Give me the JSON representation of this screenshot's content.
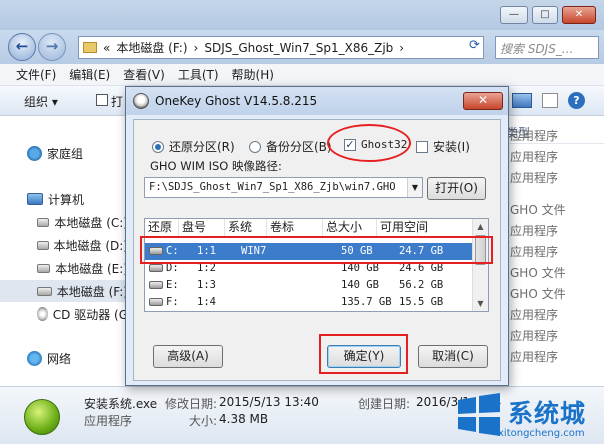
{
  "window": {
    "controls": {
      "minimize": "—",
      "maximize": "□",
      "close": "✕"
    }
  },
  "address": {
    "back": "←",
    "forward": "→",
    "crumbs": [
      "«",
      "本地磁盘 (F:)",
      "›",
      "SDJS_Ghost_Win7_Sp1_X86_Zjb",
      "›"
    ],
    "search_placeholder": "搜索 SDJS_..."
  },
  "menubar": [
    "文件(F)",
    "编辑(E)",
    "查看(V)",
    "工具(T)",
    "帮助(H)"
  ],
  "cmdbar": {
    "organize": "组织 ▾",
    "open_trunc": "打"
  },
  "navpane": {
    "items": [
      {
        "label": "家庭组",
        "icon": "homegroup-icon"
      },
      {
        "label": "计算机",
        "icon": "computer-icon"
      },
      {
        "label": "本地磁盘 (C:)",
        "icon": "drive-icon"
      },
      {
        "label": "本地磁盘 (D:)",
        "icon": "drive-icon"
      },
      {
        "label": "本地磁盘 (E:)",
        "icon": "drive-icon"
      },
      {
        "label": "本地磁盘 (F:)",
        "icon": "drive-icon"
      },
      {
        "label": "CD 驱动器 (G",
        "icon": "cd-drive-icon"
      },
      {
        "label": "网络",
        "icon": "network-icon"
      }
    ]
  },
  "filepane": {
    "col_header": "类型",
    "rows": [
      "应用程序",
      "应用程序",
      "应用程序",
      "GHO 文件",
      "应用程序",
      "应用程序",
      "GHO 文件",
      "GHO 文件",
      "应用程序",
      "应用程序",
      "应用程序"
    ]
  },
  "details": {
    "filename": "安装系统.exe",
    "modified_label": "修改日期:",
    "modified_value": "2015/5/13 13:40",
    "type": "应用程序",
    "size_label": "大小:",
    "size_value": "4.38 MB",
    "created_label": "创建日期:",
    "created_value": "2016/3/1",
    "created_tail": "34"
  },
  "dialog": {
    "title": "OneKey Ghost V14.5.8.215",
    "close": "✕",
    "restore_label": "还原分区(R)",
    "backup_label": "备份分区(B)",
    "ghost32_label": "Ghost32",
    "install_label": "安装(I)",
    "path_label": "GHO WIM ISO 映像路径:",
    "path_value": "F:\\SDJS_Ghost_Win7_Sp1_X86_Zjb\\win7.GHO",
    "open_button": "打开(O)",
    "advanced_button": "高级(A)",
    "ok_button": "确定(Y)",
    "cancel_button": "取消(C)",
    "columns": [
      "还原",
      "盘号",
      "系统",
      "卷标",
      "总大小",
      "可用空间"
    ],
    "partitions": [
      {
        "drive": "C:",
        "num": "1:1",
        "os": "WIN7",
        "label": "",
        "total": "50 GB",
        "free": "24.7 GB",
        "selected": true
      },
      {
        "drive": "D:",
        "num": "1:2",
        "os": "",
        "label": "",
        "total": "140 GB",
        "free": "24.6 GB",
        "selected": false
      },
      {
        "drive": "E:",
        "num": "1:3",
        "os": "",
        "label": "",
        "total": "140 GB",
        "free": "56.2 GB",
        "selected": false
      },
      {
        "drive": "F:",
        "num": "1:4",
        "os": "",
        "label": "",
        "total": "135.7 GB",
        "free": "15.5 GB",
        "selected": false
      }
    ],
    "scroll_up": "▲",
    "scroll_down": "▼",
    "combo_arrow": "▼"
  },
  "watermark": {
    "title": "系统城",
    "url": "xitongcheng.com"
  }
}
